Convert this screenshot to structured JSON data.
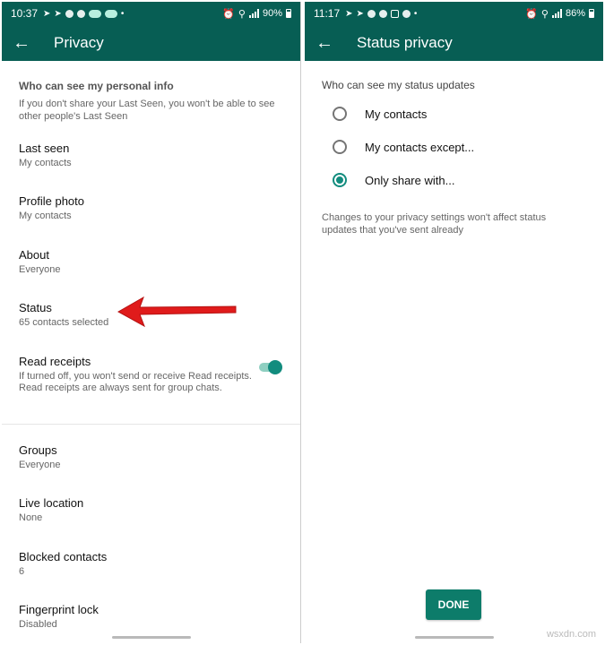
{
  "colors": {
    "primary": "#075e54",
    "accent": "#128c7e",
    "arrow": "#e01b1b"
  },
  "left": {
    "status_time": "10:37",
    "battery": "90%",
    "title": "Privacy",
    "section_header": "Who can see my personal info",
    "section_sub": "If you don't share your Last Seen, you won't be able to see other people's Last Seen",
    "items": [
      {
        "title": "Last seen",
        "sub": "My contacts"
      },
      {
        "title": "Profile photo",
        "sub": "My contacts"
      },
      {
        "title": "About",
        "sub": "Everyone"
      },
      {
        "title": "Status",
        "sub": "65 contacts selected"
      },
      {
        "title": "Read receipts",
        "sub": "If turned off, you won't send or receive Read receipts. Read receipts are always sent for group chats."
      },
      {
        "title": "Groups",
        "sub": "Everyone"
      },
      {
        "title": "Live location",
        "sub": "None"
      },
      {
        "title": "Blocked contacts",
        "sub": "6"
      },
      {
        "title": "Fingerprint lock",
        "sub": "Disabled"
      }
    ],
    "read_receipts_on": true
  },
  "right": {
    "status_time": "11:17",
    "battery": "86%",
    "title": "Status privacy",
    "section_header": "Who can see my status updates",
    "options": [
      {
        "label": "My contacts",
        "checked": false
      },
      {
        "label": "My contacts except...",
        "checked": false
      },
      {
        "label": "Only share with...",
        "checked": true
      }
    ],
    "note": "Changes to your privacy settings won't affect status updates that you've sent already",
    "done_label": "DONE"
  },
  "watermark": "wsxdn.com"
}
